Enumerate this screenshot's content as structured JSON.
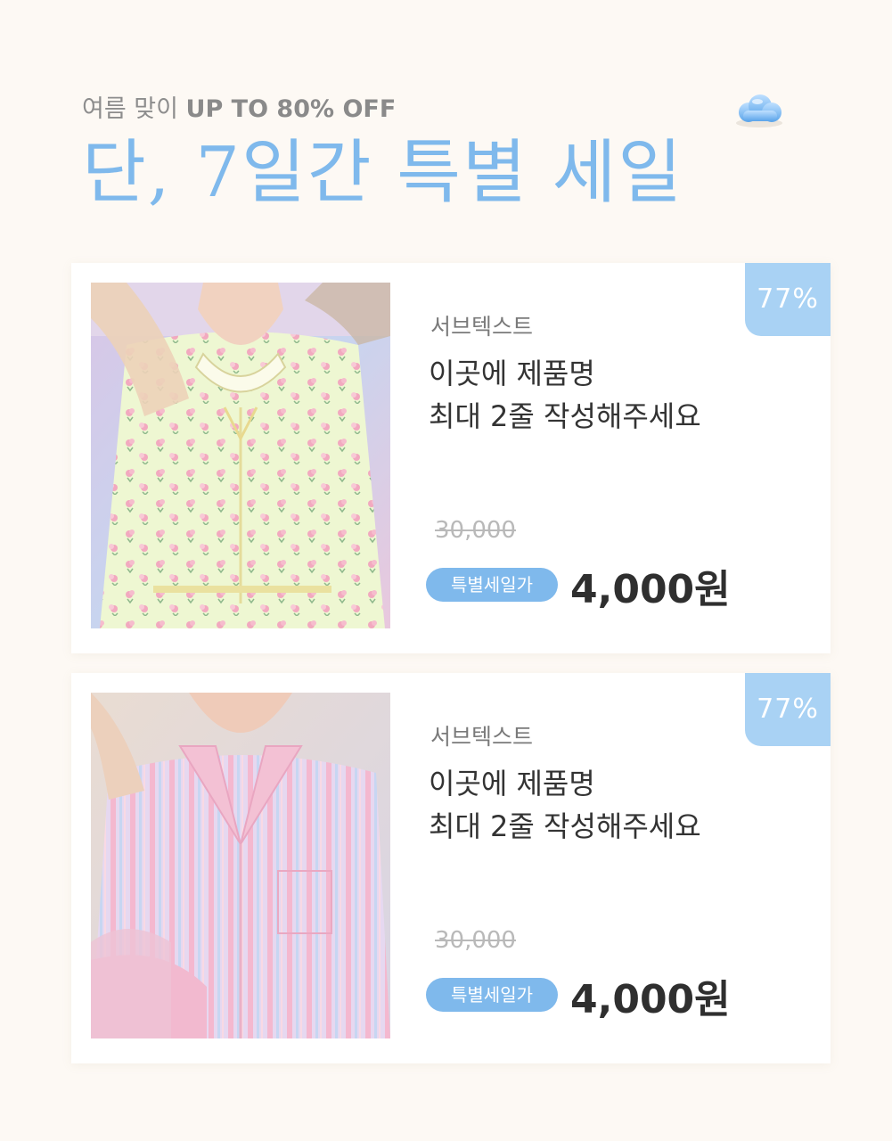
{
  "header": {
    "subtitle_prefix": "여름 맞이",
    "subtitle_highlight": "UP TO 80% OFF",
    "title": "단, 7일간 특별 세일",
    "cloud_icon": "cloud-icon"
  },
  "colors": {
    "accent": "#7fb9ec",
    "badge": "#a9d2f4",
    "background": "#fdf9f4",
    "card": "#ffffff"
  },
  "products": [
    {
      "discount": "77%",
      "subtext": "서브텍스트",
      "name_line1": "이곳에 제품명",
      "name_line2": "최대 2줄 작성해주세요",
      "original_price": "30,000",
      "sale_label": "특별세일가",
      "sale_price": "4,000원",
      "image": "floral-pajama-photo"
    },
    {
      "discount": "77%",
      "subtext": "서브텍스트",
      "name_line1": "이곳에 제품명",
      "name_line2": "최대 2줄 작성해주세요",
      "original_price": "30,000",
      "sale_label": "특별세일가",
      "sale_price": "4,000원",
      "image": "striped-pajama-photo"
    }
  ]
}
